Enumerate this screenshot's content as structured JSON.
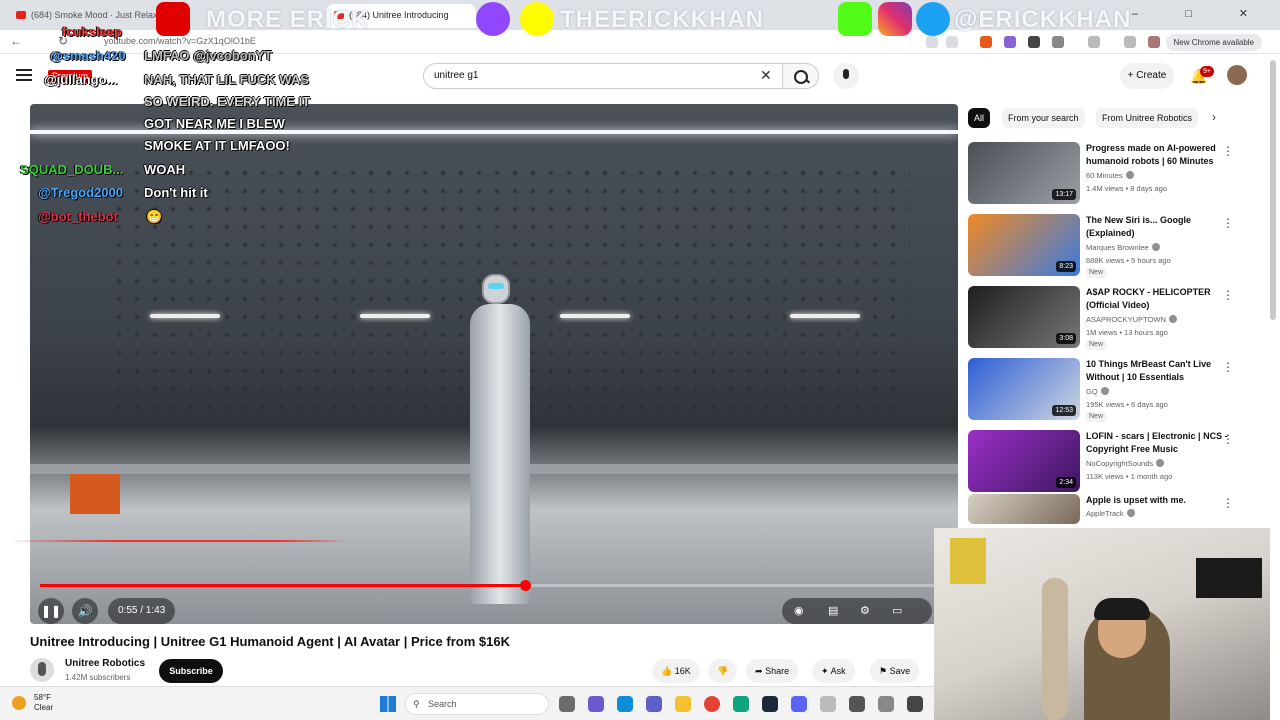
{
  "browser": {
    "tabs": [
      {
        "title": "(684) Smoke Mood · Just Relax"
      },
      {
        "title": "(684) Unitree Introducing"
      }
    ],
    "url": "youtube.com/watch?v=GzX1qOlO1bE",
    "new_chrome_label": "New Chrome available",
    "window_controls": "– □ ✕"
  },
  "youtube": {
    "search_value": "unitree g1",
    "create_label": "Create",
    "notification_count": "9+"
  },
  "video": {
    "current_time": "0:55",
    "duration": "1:43",
    "time_display": "0:55 / 1:43",
    "progress": 0.534,
    "title": "Unitree Introducing | Unitree G1 Humanoid Agent | AI Avatar | Price from $16K",
    "channel": "Unitree Robotics",
    "subscribers": "1.42M subscribers",
    "subscribe_label": "Subscribe",
    "like_count": "16K",
    "share_label": "Share",
    "ask_label": "Ask",
    "save_label": "Save"
  },
  "chips": [
    "All",
    "From your search",
    "From Unitree Robotics"
  ],
  "recommendations": [
    {
      "title": "Progress made on AI-powered humanoid robots | 60 Minutes",
      "channel": "60 Minutes",
      "meta": "1.4M views • 8 days ago",
      "duration": "13:17",
      "new": "",
      "colors": [
        "#4a4f55",
        "#9aa0a6"
      ]
    },
    {
      "title": "The New Siri is... Google (Explained)",
      "channel": "Marques Brownlee",
      "meta": "688K views • 5 hours ago",
      "duration": "8:23",
      "new": "New",
      "colors": [
        "#f08a24",
        "#3a7be0"
      ]
    },
    {
      "title": "A$AP ROCKY - HELICOPTER (Official Video)",
      "channel": "ASAPROCKYUPTOWN",
      "meta": "1M views • 13 hours ago",
      "duration": "3:08",
      "new": "New",
      "colors": [
        "#1e1e1e",
        "#777777"
      ]
    },
    {
      "title": "10 Things MrBeast Can't Live Without | 10 Essentials",
      "channel": "GQ",
      "meta": "195K views • 6 days ago",
      "duration": "12:53",
      "new": "New",
      "colors": [
        "#2d5ed6",
        "#cfd6e0"
      ]
    },
    {
      "title": "LOFIN - scars | Electronic | NCS - Copyright Free Music",
      "channel": "NoCopyrightSounds",
      "meta": "113K views • 1 month ago",
      "duration": "2:34",
      "new": "",
      "colors": [
        "#9b2fc7",
        "#3d1760"
      ]
    },
    {
      "title": "Apple is upset with me.",
      "channel": "AppleTrack",
      "meta": "",
      "duration": "",
      "new": "",
      "colors": [
        "#d8d0c4",
        "#7a6a58"
      ]
    }
  ],
  "stream": {
    "banner_handles": [
      "MORE ERICK",
      "THEERICKKHAN",
      "@ERICKKHAN"
    ],
    "chat": [
      {
        "user": "fcuksleep",
        "msg": "",
        "user_color": "#ff3b3b"
      },
      {
        "user": "@smash420",
        "msg": "LMFAO @jvcobonYT",
        "user_color": "#5aa9ff"
      },
      {
        "user": "@jullango...",
        "msg": "NAH, THAT LIL FUCK WAS",
        "user_color": "#ffffff"
      },
      {
        "user": "",
        "msg": "SO WEIRD. EVERY TIME IT",
        "user_color": "#ffffff"
      },
      {
        "user": "",
        "msg": "GOT NEAR ME I BLEW",
        "user_color": "#ffffff"
      },
      {
        "user": "",
        "msg": "SMOKE AT IT LMFAOO!",
        "user_color": "#ffffff"
      },
      {
        "user": "SQUAD_DOUB...",
        "msg": "WOAH",
        "user_color": "#3bd13b"
      },
      {
        "user": "@Tregod2000",
        "msg": "Don't hit it",
        "user_color": "#4aa8ff"
      },
      {
        "user": "@bot_thebot",
        "msg": "😁",
        "user_color": "#d9344a"
      }
    ],
    "premium_label": "Premium"
  },
  "taskbar": {
    "temperature": "58°F",
    "condition": "Clear",
    "search_placeholder": "Search"
  },
  "icons": {
    "back": "←",
    "reload": "↻",
    "play_pause": "❚❚",
    "volume": "🔊",
    "like": "👍",
    "dislike": "👎",
    "share": "➦",
    "ask": "✦",
    "save": "⚑",
    "kebab": "⋮",
    "bell": "🔔",
    "clear": "✕",
    "chevron_right": "›",
    "plus": "+"
  }
}
